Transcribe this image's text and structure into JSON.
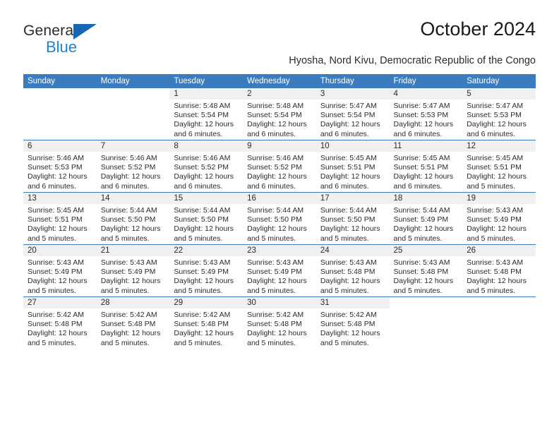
{
  "brand": {
    "name_top": "General",
    "name_bottom": "Blue",
    "accent_color": "#1a84d6",
    "triangle_color": "#1567b2"
  },
  "header": {
    "title": "October 2024",
    "subtitle": "Hyosha, Nord Kivu, Democratic Republic of the Congo"
  },
  "calendar": {
    "header_bg": "#3a7cbe",
    "daynum_band_bg": "#f0f0f0",
    "weekdays": [
      "Sunday",
      "Monday",
      "Tuesday",
      "Wednesday",
      "Thursday",
      "Friday",
      "Saturday"
    ],
    "weeks": [
      [
        {
          "day": "",
          "sunrise": "",
          "sunset": "",
          "daylight1": "",
          "daylight2": ""
        },
        {
          "day": "",
          "sunrise": "",
          "sunset": "",
          "daylight1": "",
          "daylight2": ""
        },
        {
          "day": "1",
          "sunrise": "Sunrise: 5:48 AM",
          "sunset": "Sunset: 5:54 PM",
          "daylight1": "Daylight: 12 hours",
          "daylight2": "and 6 minutes."
        },
        {
          "day": "2",
          "sunrise": "Sunrise: 5:48 AM",
          "sunset": "Sunset: 5:54 PM",
          "daylight1": "Daylight: 12 hours",
          "daylight2": "and 6 minutes."
        },
        {
          "day": "3",
          "sunrise": "Sunrise: 5:47 AM",
          "sunset": "Sunset: 5:54 PM",
          "daylight1": "Daylight: 12 hours",
          "daylight2": "and 6 minutes."
        },
        {
          "day": "4",
          "sunrise": "Sunrise: 5:47 AM",
          "sunset": "Sunset: 5:53 PM",
          "daylight1": "Daylight: 12 hours",
          "daylight2": "and 6 minutes."
        },
        {
          "day": "5",
          "sunrise": "Sunrise: 5:47 AM",
          "sunset": "Sunset: 5:53 PM",
          "daylight1": "Daylight: 12 hours",
          "daylight2": "and 6 minutes."
        }
      ],
      [
        {
          "day": "6",
          "sunrise": "Sunrise: 5:46 AM",
          "sunset": "Sunset: 5:53 PM",
          "daylight1": "Daylight: 12 hours",
          "daylight2": "and 6 minutes."
        },
        {
          "day": "7",
          "sunrise": "Sunrise: 5:46 AM",
          "sunset": "Sunset: 5:52 PM",
          "daylight1": "Daylight: 12 hours",
          "daylight2": "and 6 minutes."
        },
        {
          "day": "8",
          "sunrise": "Sunrise: 5:46 AM",
          "sunset": "Sunset: 5:52 PM",
          "daylight1": "Daylight: 12 hours",
          "daylight2": "and 6 minutes."
        },
        {
          "day": "9",
          "sunrise": "Sunrise: 5:46 AM",
          "sunset": "Sunset: 5:52 PM",
          "daylight1": "Daylight: 12 hours",
          "daylight2": "and 6 minutes."
        },
        {
          "day": "10",
          "sunrise": "Sunrise: 5:45 AM",
          "sunset": "Sunset: 5:51 PM",
          "daylight1": "Daylight: 12 hours",
          "daylight2": "and 6 minutes."
        },
        {
          "day": "11",
          "sunrise": "Sunrise: 5:45 AM",
          "sunset": "Sunset: 5:51 PM",
          "daylight1": "Daylight: 12 hours",
          "daylight2": "and 6 minutes."
        },
        {
          "day": "12",
          "sunrise": "Sunrise: 5:45 AM",
          "sunset": "Sunset: 5:51 PM",
          "daylight1": "Daylight: 12 hours",
          "daylight2": "and 5 minutes."
        }
      ],
      [
        {
          "day": "13",
          "sunrise": "Sunrise: 5:45 AM",
          "sunset": "Sunset: 5:51 PM",
          "daylight1": "Daylight: 12 hours",
          "daylight2": "and 5 minutes."
        },
        {
          "day": "14",
          "sunrise": "Sunrise: 5:44 AM",
          "sunset": "Sunset: 5:50 PM",
          "daylight1": "Daylight: 12 hours",
          "daylight2": "and 5 minutes."
        },
        {
          "day": "15",
          "sunrise": "Sunrise: 5:44 AM",
          "sunset": "Sunset: 5:50 PM",
          "daylight1": "Daylight: 12 hours",
          "daylight2": "and 5 minutes."
        },
        {
          "day": "16",
          "sunrise": "Sunrise: 5:44 AM",
          "sunset": "Sunset: 5:50 PM",
          "daylight1": "Daylight: 12 hours",
          "daylight2": "and 5 minutes."
        },
        {
          "day": "17",
          "sunrise": "Sunrise: 5:44 AM",
          "sunset": "Sunset: 5:50 PM",
          "daylight1": "Daylight: 12 hours",
          "daylight2": "and 5 minutes."
        },
        {
          "day": "18",
          "sunrise": "Sunrise: 5:44 AM",
          "sunset": "Sunset: 5:49 PM",
          "daylight1": "Daylight: 12 hours",
          "daylight2": "and 5 minutes."
        },
        {
          "day": "19",
          "sunrise": "Sunrise: 5:43 AM",
          "sunset": "Sunset: 5:49 PM",
          "daylight1": "Daylight: 12 hours",
          "daylight2": "and 5 minutes."
        }
      ],
      [
        {
          "day": "20",
          "sunrise": "Sunrise: 5:43 AM",
          "sunset": "Sunset: 5:49 PM",
          "daylight1": "Daylight: 12 hours",
          "daylight2": "and 5 minutes."
        },
        {
          "day": "21",
          "sunrise": "Sunrise: 5:43 AM",
          "sunset": "Sunset: 5:49 PM",
          "daylight1": "Daylight: 12 hours",
          "daylight2": "and 5 minutes."
        },
        {
          "day": "22",
          "sunrise": "Sunrise: 5:43 AM",
          "sunset": "Sunset: 5:49 PM",
          "daylight1": "Daylight: 12 hours",
          "daylight2": "and 5 minutes."
        },
        {
          "day": "23",
          "sunrise": "Sunrise: 5:43 AM",
          "sunset": "Sunset: 5:49 PM",
          "daylight1": "Daylight: 12 hours",
          "daylight2": "and 5 minutes."
        },
        {
          "day": "24",
          "sunrise": "Sunrise: 5:43 AM",
          "sunset": "Sunset: 5:48 PM",
          "daylight1": "Daylight: 12 hours",
          "daylight2": "and 5 minutes."
        },
        {
          "day": "25",
          "sunrise": "Sunrise: 5:43 AM",
          "sunset": "Sunset: 5:48 PM",
          "daylight1": "Daylight: 12 hours",
          "daylight2": "and 5 minutes."
        },
        {
          "day": "26",
          "sunrise": "Sunrise: 5:43 AM",
          "sunset": "Sunset: 5:48 PM",
          "daylight1": "Daylight: 12 hours",
          "daylight2": "and 5 minutes."
        }
      ],
      [
        {
          "day": "27",
          "sunrise": "Sunrise: 5:42 AM",
          "sunset": "Sunset: 5:48 PM",
          "daylight1": "Daylight: 12 hours",
          "daylight2": "and 5 minutes."
        },
        {
          "day": "28",
          "sunrise": "Sunrise: 5:42 AM",
          "sunset": "Sunset: 5:48 PM",
          "daylight1": "Daylight: 12 hours",
          "daylight2": "and 5 minutes."
        },
        {
          "day": "29",
          "sunrise": "Sunrise: 5:42 AM",
          "sunset": "Sunset: 5:48 PM",
          "daylight1": "Daylight: 12 hours",
          "daylight2": "and 5 minutes."
        },
        {
          "day": "30",
          "sunrise": "Sunrise: 5:42 AM",
          "sunset": "Sunset: 5:48 PM",
          "daylight1": "Daylight: 12 hours",
          "daylight2": "and 5 minutes."
        },
        {
          "day": "31",
          "sunrise": "Sunrise: 5:42 AM",
          "sunset": "Sunset: 5:48 PM",
          "daylight1": "Daylight: 12 hours",
          "daylight2": "and 5 minutes."
        },
        {
          "day": "",
          "sunrise": "",
          "sunset": "",
          "daylight1": "",
          "daylight2": ""
        },
        {
          "day": "",
          "sunrise": "",
          "sunset": "",
          "daylight1": "",
          "daylight2": ""
        }
      ]
    ]
  }
}
